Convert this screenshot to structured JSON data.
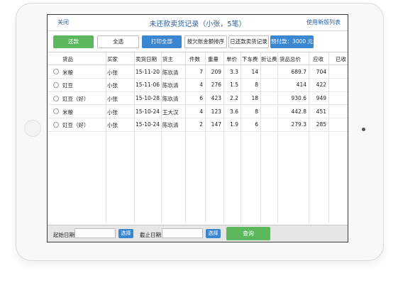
{
  "header": {
    "close_label": "关闭",
    "title": "未还款卖货记录（小张，5笔）",
    "new_list_label": "使用新版列表"
  },
  "toolbar": {
    "repay_label": "还款",
    "select_all_label": "全选",
    "print_all_label": "打印全部",
    "sort_by_debt_label": "按欠账金额排序",
    "repaid_records_label": "已还款卖货记录",
    "prepaid_label": "预付款：3000 元"
  },
  "table": {
    "columns": [
      "货品",
      "买家",
      "卖货日期",
      "货主",
      "件数",
      "重量",
      "单价",
      "下车费",
      "折让费",
      "货品总价",
      "应收",
      "已收"
    ],
    "rows": [
      {
        "goods": "米粮",
        "buyer": "小张",
        "date": "15-11-20",
        "owner": "陈玖清",
        "qty": "7",
        "weight": "209",
        "price": "3.3",
        "unload": "14",
        "discount": "",
        "total": "689.7",
        "receivable": "704",
        "received": ""
      },
      {
        "goods": "豇豆",
        "buyer": "小张",
        "date": "15-11-06",
        "owner": "陈玖清",
        "qty": "4",
        "weight": "276",
        "price": "1.5",
        "unload": "8",
        "discount": "",
        "total": "414",
        "receivable": "422",
        "received": ""
      },
      {
        "goods": "豇豆（好）",
        "buyer": "小张",
        "date": "15-10-28",
        "owner": "陈玖清",
        "qty": "6",
        "weight": "423",
        "price": "2.2",
        "unload": "18",
        "discount": "",
        "total": "930.6",
        "receivable": "949",
        "received": ""
      },
      {
        "goods": "米粮",
        "buyer": "小张",
        "date": "15-10-24",
        "owner": "王大汉",
        "qty": "4",
        "weight": "123",
        "price": "3.6",
        "unload": "8",
        "discount": "",
        "total": "442.8",
        "receivable": "451",
        "received": ""
      },
      {
        "goods": "豇豆（好）",
        "buyer": "小张",
        "date": "15-10-24",
        "owner": "陈玖清",
        "qty": "2",
        "weight": "147",
        "price": "1.9",
        "unload": "6",
        "discount": "",
        "total": "279.3",
        "receivable": "285",
        "received": ""
      }
    ]
  },
  "footer": {
    "start_date_label": "起始日期",
    "start_date_value": "",
    "start_pick_label": "选择",
    "end_date_label": "截止日期",
    "end_date_value": "",
    "end_pick_label": "选择",
    "query_label": "查询"
  },
  "colors": {
    "accent_blue": "#3a86d0",
    "accent_green": "#5cb85c",
    "title_blue": "#2a5fa8"
  }
}
